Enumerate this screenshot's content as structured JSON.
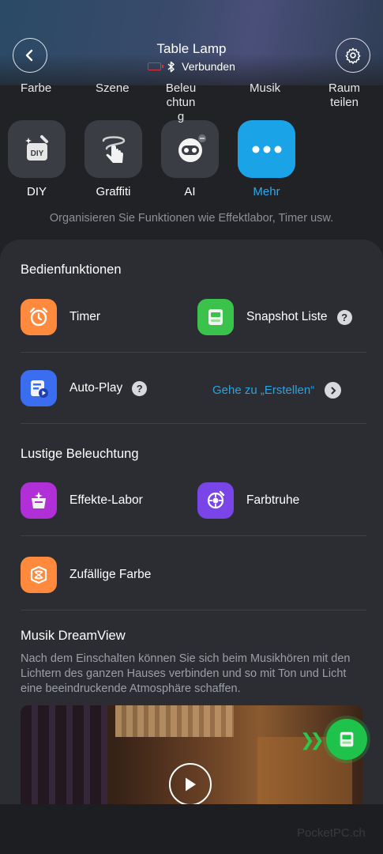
{
  "header": {
    "title": "Table Lamp",
    "status": "Verbunden"
  },
  "tabs": [
    {
      "label": "Farbe"
    },
    {
      "label": "Szene"
    },
    {
      "label": "Beleuchtung"
    },
    {
      "label": "Musik"
    },
    {
      "label": "Raum teilen"
    }
  ],
  "tiles": [
    {
      "label": "DIY",
      "icon_text": "DIY"
    },
    {
      "label": "Graffiti"
    },
    {
      "label": "AI"
    },
    {
      "label": "Mehr"
    }
  ],
  "hint": "Organisieren Sie Funktionen wie Effektlabor, Timer usw.",
  "sections": {
    "bedien_title": "Bedienfunktionen",
    "timer": "Timer",
    "snapshot": "Snapshot Liste",
    "autoplay": "Auto-Play",
    "goto": "Gehe zu „Erstellen“",
    "lustige_title": "Lustige Beleuchtung",
    "effekte": "Effekte-Labor",
    "farbtruhe": "Farbtruhe",
    "zufall": "Zufällige Farbe",
    "musik_title": "Musik DreamView",
    "musik_desc": "Nach dem Einschalten können Sie sich beim Musikhören mit den Lichtern des ganzen Hauses verbinden und so mit Ton und Licht eine beeindruckende Atmosphäre schaffen."
  },
  "help_glyph": "?",
  "watermark": "PocketPC.ch",
  "colors": {
    "accent_blue": "#1ba3e7",
    "timer_orange": "#ff8a3d",
    "snapshot_green": "#3bc24a",
    "autoplay_blue": "#3a6df0",
    "effekte_purple": "#b02fd6",
    "farbtruhe_violet": "#7a45e8",
    "zufall_orange": "#ff8a3d",
    "battery_red": "#e0313a"
  }
}
